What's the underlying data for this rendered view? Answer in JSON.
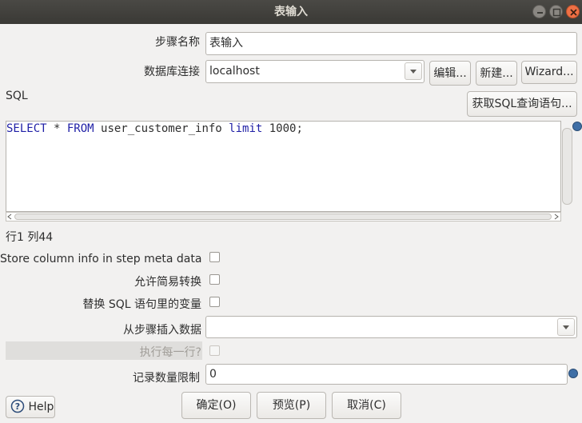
{
  "window": {
    "title": "表输入"
  },
  "form": {
    "step_name_label": "步骤名称",
    "step_name_value": "表输入",
    "db_connection_label": "数据库连接",
    "db_connection_value": "localhost",
    "edit_button": "编辑...",
    "new_button": "新建...",
    "wizard_button": "Wizard...",
    "sql_label": "SQL",
    "get_sql_button": "获取SQL查询语句...",
    "sql": {
      "kw1": "SELECT",
      "t1": " * ",
      "kw2": "FROM",
      "t2": " user_customer_info ",
      "kw3": "limit",
      "t3": " 1000;"
    },
    "cursor_position": "行1 列44",
    "store_column_info_label": "Store column info in step meta data",
    "allow_lazy_conversion_label": "允许简易转换",
    "replace_variables_label": "替换 SQL 语句里的变量",
    "insert_data_from_step_label": "从步骤插入数据",
    "insert_data_from_step_value": "",
    "execute_each_row_label": "执行每一行?",
    "limit_size_label": "记录数量限制",
    "limit_size_value": "0"
  },
  "buttons": {
    "ok": "确定(O)",
    "preview": "预览(P)",
    "cancel": "取消(C)",
    "help": "Help"
  },
  "checkboxes": {
    "store_column_info": false,
    "allow_lazy_conversion": false,
    "replace_variables": false,
    "execute_each_row": false
  },
  "colors": {
    "titlebar": "#3c3b37",
    "close_button": "#ef7045",
    "sql_keyword": "#1f1fa6",
    "variable_icon": "#3f6fa6"
  },
  "icons": [
    "minimize-icon",
    "maximize-icon",
    "close-icon",
    "chevron-down-icon",
    "variable-icon",
    "help-icon"
  ]
}
